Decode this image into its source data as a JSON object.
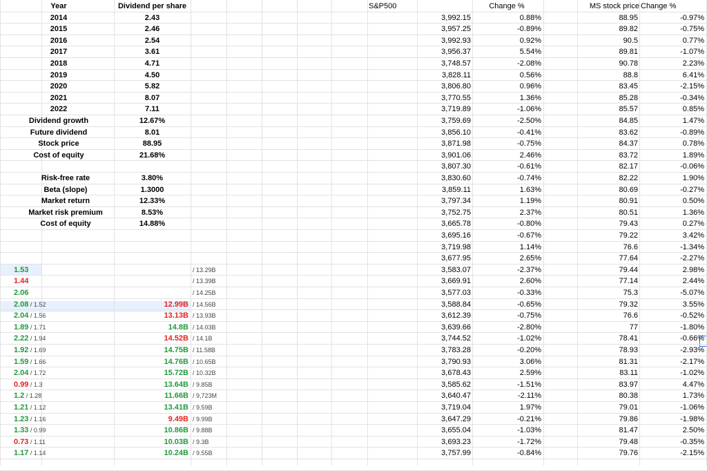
{
  "summary_headers": {
    "year": "Year",
    "dividend": "Dividend per share"
  },
  "dividends": [
    {
      "year": "2014",
      "dps": "2.43"
    },
    {
      "year": "2015",
      "dps": "2.46"
    },
    {
      "year": "2016",
      "dps": "2.54"
    },
    {
      "year": "2017",
      "dps": "3.61"
    },
    {
      "year": "2018",
      "dps": "4.71"
    },
    {
      "year": "2019",
      "dps": "4.50"
    },
    {
      "year": "2020",
      "dps": "5.82"
    },
    {
      "year": "2021",
      "dps": "8.07"
    },
    {
      "year": "2022",
      "dps": "7.11"
    }
  ],
  "ddm": [
    {
      "label": "Dividend growth",
      "value": "12.67%"
    },
    {
      "label": "Future dividend",
      "value": "8.01"
    },
    {
      "label": "Stock price",
      "value": "88.95"
    },
    {
      "label": "Cost of equity",
      "value": "21.68%"
    }
  ],
  "capm": [
    {
      "label": "Risk-free rate",
      "value": "3.80%"
    },
    {
      "label": "Beta (slope)",
      "value": "1.3000"
    },
    {
      "label": "Market return",
      "value": "12.33%"
    },
    {
      "label": "Market risk premium",
      "value": "8.53%"
    },
    {
      "label": "Cost of equity",
      "value": "14.88%"
    }
  ],
  "pasted_rows": [
    {
      "a": "1.53",
      "a_color": "green",
      "a_sub": "",
      "b": "",
      "b_color": "",
      "c": "/ 13.29B"
    },
    {
      "a": "1.44",
      "a_color": "red",
      "a_sub": "",
      "b": "",
      "b_color": "",
      "c": "/ 13.39B"
    },
    {
      "a": "2.06",
      "a_color": "green",
      "a_sub": "",
      "b": "",
      "b_color": "",
      "c": "/ 14.25B"
    },
    {
      "a": "2.08",
      "a_color": "green",
      "a_sub": "/ 1.52",
      "b": "12.99B",
      "b_color": "red",
      "c": "/ 14.56B"
    },
    {
      "a": "2.04",
      "a_color": "green",
      "a_sub": "/ 1.56",
      "b": "13.13B",
      "b_color": "red",
      "c": "/ 13.93B"
    },
    {
      "a": "1.89",
      "a_color": "green",
      "a_sub": "/ 1.71",
      "b": "14.8B",
      "b_color": "green",
      "c": "/ 14.03B"
    },
    {
      "a": "2.22",
      "a_color": "green",
      "a_sub": "/ 1.94",
      "b": "14.52B",
      "b_color": "red",
      "c": "/ 14.1B"
    },
    {
      "a": "1.92",
      "a_color": "green",
      "a_sub": "/ 1.69",
      "b": "14.75B",
      "b_color": "green",
      "c": "/ 11.58B"
    },
    {
      "a": "1.59",
      "a_color": "green",
      "a_sub": "/ 1.66",
      "b": "14.76B",
      "b_color": "green",
      "c": "/ 10.65B"
    },
    {
      "a": "2.04",
      "a_color": "green",
      "a_sub": "/ 1.72",
      "b": "15.72B",
      "b_color": "green",
      "c": "/ 10.32B"
    },
    {
      "a": "0.99",
      "a_color": "red",
      "a_sub": "/ 1.3",
      "b": "13.64B",
      "b_color": "green",
      "c": "/ 9.85B"
    },
    {
      "a": "1.2",
      "a_color": "green",
      "a_sub": "/ 1.28",
      "b": "11.66B",
      "b_color": "green",
      "c": "/ 9,723M"
    },
    {
      "a": "1.21",
      "a_color": "green",
      "a_sub": "/ 1.12",
      "b": "13.41B",
      "b_color": "green",
      "c": "/ 9.59B"
    },
    {
      "a": "1.23",
      "a_color": "green",
      "a_sub": "/ 1.16",
      "b": "9.49B",
      "b_color": "red",
      "c": "/ 9.99B"
    },
    {
      "a": "1.33",
      "a_color": "green",
      "a_sub": "/ 0.99",
      "b": "10.86B",
      "b_color": "green",
      "c": "/ 9.88B"
    },
    {
      "a": "0.73",
      "a_color": "red",
      "a_sub": "/ 1.11",
      "b": "10.03B",
      "b_color": "green",
      "c": "/ 9.3B"
    },
    {
      "a": "1.17",
      "a_color": "green",
      "a_sub": "/ 1.14",
      "b": "10.24B",
      "b_color": "green",
      "c": "/ 9.55B"
    }
  ],
  "market_headers": {
    "sp": "S&P500",
    "sp_chg": "Change %",
    "ms": "MS stock price",
    "ms_chg": "Change %"
  },
  "market_rows": [
    {
      "sp": "3,992.15",
      "sp_chg": "0.88%",
      "ms": "88.95",
      "ms_chg": "-0.97%"
    },
    {
      "sp": "3,957.25",
      "sp_chg": "-0.89%",
      "ms": "89.82",
      "ms_chg": "-0.75%"
    },
    {
      "sp": "3,992.93",
      "sp_chg": "0.92%",
      "ms": "90.5",
      "ms_chg": "0.77%"
    },
    {
      "sp": "3,956.37",
      "sp_chg": "5.54%",
      "ms": "89.81",
      "ms_chg": "-1.07%"
    },
    {
      "sp": "3,748.57",
      "sp_chg": "-2.08%",
      "ms": "90.78",
      "ms_chg": "2.23%"
    },
    {
      "sp": "3,828.11",
      "sp_chg": "0.56%",
      "ms": "88.8",
      "ms_chg": "6.41%"
    },
    {
      "sp": "3,806.80",
      "sp_chg": "0.96%",
      "ms": "83.45",
      "ms_chg": "-2.15%"
    },
    {
      "sp": "3,770.55",
      "sp_chg": "1.36%",
      "ms": "85.28",
      "ms_chg": "-0.34%"
    },
    {
      "sp": "3,719.89",
      "sp_chg": "-1.06%",
      "ms": "85.57",
      "ms_chg": "0.85%"
    },
    {
      "sp": "3,759.69",
      "sp_chg": "-2.50%",
      "ms": "84.85",
      "ms_chg": "1.47%"
    },
    {
      "sp": "3,856.10",
      "sp_chg": "-0.41%",
      "ms": "83.62",
      "ms_chg": "-0.89%"
    },
    {
      "sp": "3,871.98",
      "sp_chg": "-0.75%",
      "ms": "84.37",
      "ms_chg": "0.78%"
    },
    {
      "sp": "3,901.06",
      "sp_chg": "2.46%",
      "ms": "83.72",
      "ms_chg": "1.89%"
    },
    {
      "sp": "3,807.30",
      "sp_chg": "-0.61%",
      "ms": "82.17",
      "ms_chg": "-0.06%"
    },
    {
      "sp": "3,830.60",
      "sp_chg": "-0.74%",
      "ms": "82.22",
      "ms_chg": "1.90%"
    },
    {
      "sp": "3,859.11",
      "sp_chg": "1.63%",
      "ms": "80.69",
      "ms_chg": "-0.27%"
    },
    {
      "sp": "3,797.34",
      "sp_chg": "1.19%",
      "ms": "80.91",
      "ms_chg": "0.50%"
    },
    {
      "sp": "3,752.75",
      "sp_chg": "2.37%",
      "ms": "80.51",
      "ms_chg": "1.36%"
    },
    {
      "sp": "3,665.78",
      "sp_chg": "-0.80%",
      "ms": "79.43",
      "ms_chg": "0.27%"
    },
    {
      "sp": "3,695.16",
      "sp_chg": "-0.67%",
      "ms": "79.22",
      "ms_chg": "3.42%"
    },
    {
      "sp": "3,719.98",
      "sp_chg": "1.14%",
      "ms": "76.6",
      "ms_chg": "-1.34%"
    },
    {
      "sp": "3,677.95",
      "sp_chg": "2.65%",
      "ms": "77.64",
      "ms_chg": "-2.27%"
    },
    {
      "sp": "3,583.07",
      "sp_chg": "-2.37%",
      "ms": "79.44",
      "ms_chg": "2.98%"
    },
    {
      "sp": "3,669.91",
      "sp_chg": "2.60%",
      "ms": "77.14",
      "ms_chg": "2.44%"
    },
    {
      "sp": "3,577.03",
      "sp_chg": "-0.33%",
      "ms": "75.3",
      "ms_chg": "-5.07%"
    },
    {
      "sp": "3,588.84",
      "sp_chg": "-0.65%",
      "ms": "79.32",
      "ms_chg": "3.55%"
    },
    {
      "sp": "3,612.39",
      "sp_chg": "-0.75%",
      "ms": "76.6",
      "ms_chg": "-0.52%"
    },
    {
      "sp": "3,639.66",
      "sp_chg": "-2.80%",
      "ms": "77",
      "ms_chg": "-1.80%"
    },
    {
      "sp": "3,744.52",
      "sp_chg": "-1.02%",
      "ms": "78.41",
      "ms_chg": "-0.66%"
    },
    {
      "sp": "3,783.28",
      "sp_chg": "-0.20%",
      "ms": "78.93",
      "ms_chg": "-2.93%"
    },
    {
      "sp": "3,790.93",
      "sp_chg": "3.06%",
      "ms": "81.31",
      "ms_chg": "-2.17%"
    },
    {
      "sp": "3,678.43",
      "sp_chg": "2.59%",
      "ms": "83.11",
      "ms_chg": "-1.02%"
    },
    {
      "sp": "3,585.62",
      "sp_chg": "-1.51%",
      "ms": "83.97",
      "ms_chg": "4.47%"
    },
    {
      "sp": "3,640.47",
      "sp_chg": "-2.11%",
      "ms": "80.38",
      "ms_chg": "1.73%"
    },
    {
      "sp": "3,719.04",
      "sp_chg": "1.97%",
      "ms": "79.01",
      "ms_chg": "-1.06%"
    },
    {
      "sp": "3,647.29",
      "sp_chg": "-0.21%",
      "ms": "79.86",
      "ms_chg": "-1.98%"
    },
    {
      "sp": "3,655.04",
      "sp_chg": "-1.03%",
      "ms": "81.47",
      "ms_chg": "2.50%"
    },
    {
      "sp": "3,693.23",
      "sp_chg": "-1.72%",
      "ms": "79.48",
      "ms_chg": "-0.35%"
    },
    {
      "sp": "3,757.99",
      "sp_chg": "-0.84%",
      "ms": "79.76",
      "ms_chg": "-2.15%"
    }
  ]
}
